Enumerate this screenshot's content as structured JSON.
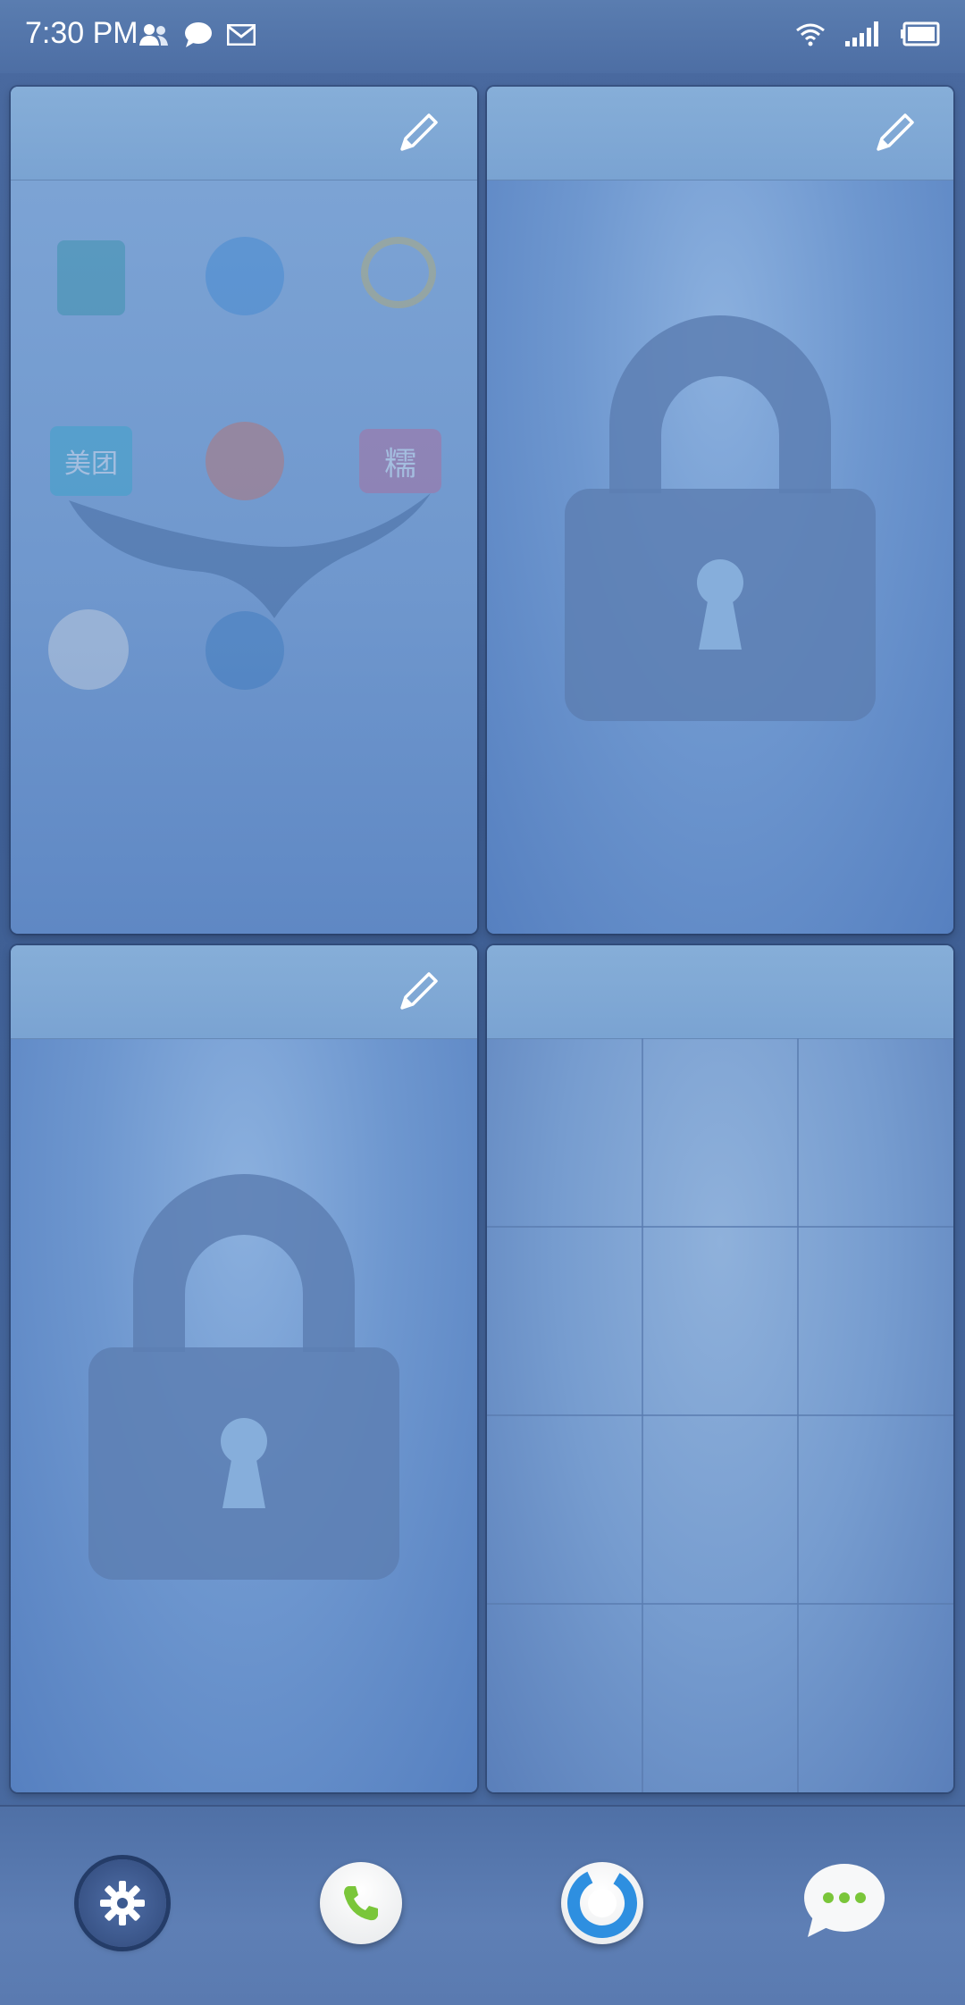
{
  "status_bar": {
    "time": "7:30 PM",
    "left_icons": [
      "contacts-icon",
      "message-bubble-icon",
      "mail-icon"
    ],
    "right_icons": [
      "wifi-icon",
      "signal-icon",
      "battery-icon"
    ]
  },
  "panels": [
    {
      "id": "panel-1",
      "type": "app-folder",
      "icons": [
        "camel-app-icon",
        "dolphin-app-icon",
        "bird-app-icon",
        "meituan-app-icon",
        "runner-app-icon",
        "nuomi-app-icon",
        "bank-app-icon",
        "railway-app-icon"
      ],
      "labels": {
        "meituan": "美团",
        "nuomi": "糯"
      },
      "has_edit": true
    },
    {
      "id": "panel-2",
      "type": "locked",
      "has_edit": true
    },
    {
      "id": "panel-3",
      "type": "locked",
      "has_edit": true
    },
    {
      "id": "panel-4",
      "type": "empty-grid",
      "has_edit": false
    }
  ],
  "dock": {
    "buttons": [
      "settings-icon",
      "phone-icon",
      "browser-icon",
      "messaging-icon"
    ]
  },
  "colors": {
    "accent_green": "#7ac63a",
    "browser_blue": "#2e8fe0"
  }
}
